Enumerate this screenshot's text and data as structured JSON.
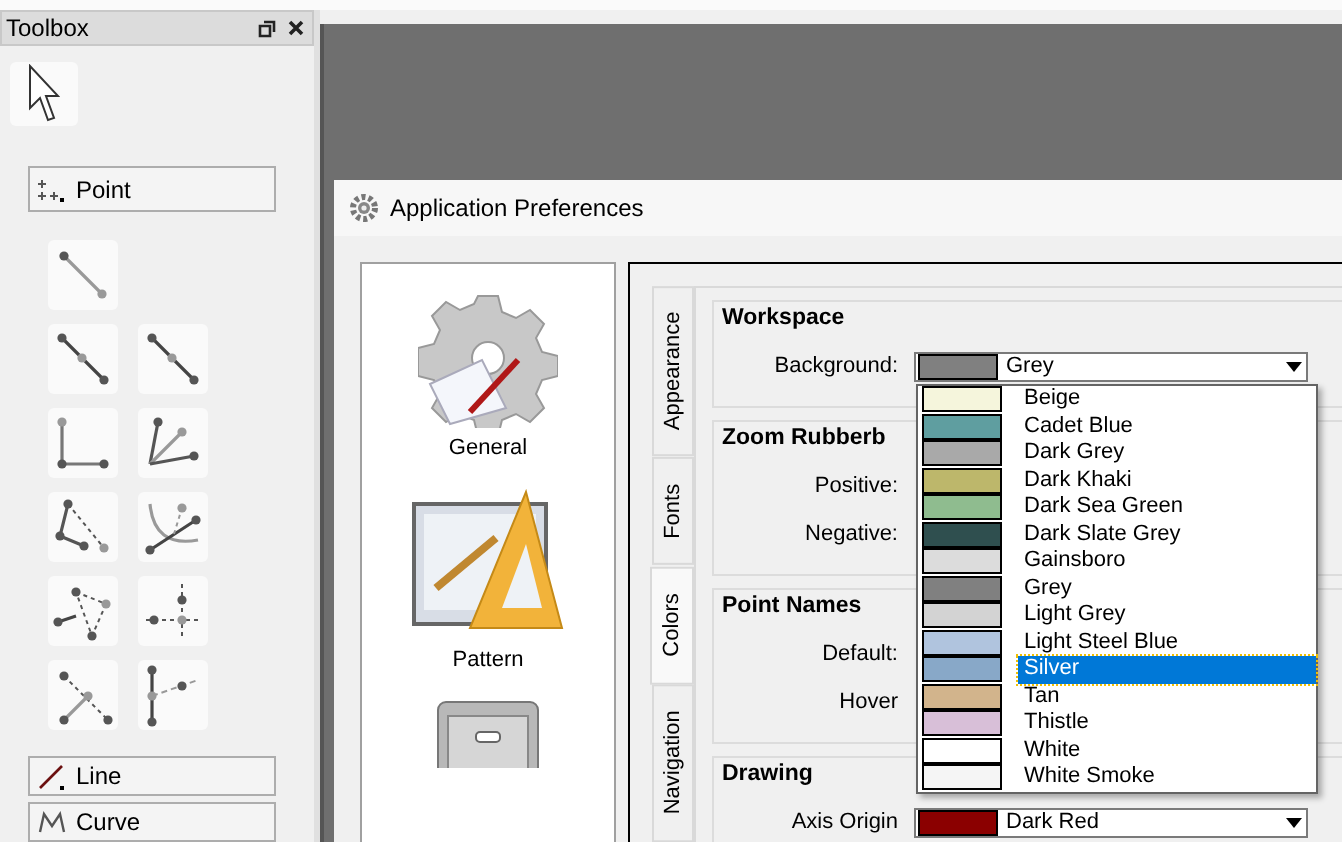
{
  "toolbox": {
    "title": "Toolbox",
    "sections": [
      {
        "label": "Point",
        "kind": "point"
      },
      {
        "label": "Line",
        "kind": "line"
      },
      {
        "label": "Curve",
        "kind": "curve"
      }
    ]
  },
  "dialog": {
    "title": "Application Preferences",
    "pages": [
      {
        "label": "General",
        "kind": "gear"
      },
      {
        "label": "Pattern",
        "kind": "pattern"
      },
      {
        "kind": "cabinet"
      }
    ],
    "tabs": [
      {
        "label": "Appearance",
        "selected": false
      },
      {
        "label": "Fonts",
        "selected": false
      },
      {
        "label": "Colors",
        "selected": true
      },
      {
        "label": "Navigation",
        "selected": false
      }
    ],
    "groups": [
      {
        "title": "Workspace",
        "rows": [
          {
            "label": "Background:",
            "value": "Grey",
            "color": "#808080"
          }
        ]
      },
      {
        "title": "Zoom Rubberb",
        "rows": [
          {
            "label": "Positive:"
          },
          {
            "label": "Negative:"
          }
        ]
      },
      {
        "title": "Point Names",
        "rows": [
          {
            "label": "Default:"
          },
          {
            "label": "Hover"
          }
        ]
      },
      {
        "title": "Drawing",
        "rows": [
          {
            "label": "Axis Origin",
            "value": "Dark Red",
            "color": "#8b0000"
          }
        ]
      }
    ],
    "dropdown": [
      {
        "label": "Beige",
        "color": "#f5f5dc",
        "selected": false
      },
      {
        "label": "Cadet Blue",
        "color": "#5f9ea0",
        "selected": false
      },
      {
        "label": "Dark Grey",
        "color": "#a9a9a9",
        "selected": false
      },
      {
        "label": "Dark Khaki",
        "color": "#bdb76b",
        "selected": false
      },
      {
        "label": "Dark Sea Green",
        "color": "#8fbc8f",
        "selected": false
      },
      {
        "label": "Dark Slate Grey",
        "color": "#2f4f4f",
        "selected": false
      },
      {
        "label": "Gainsboro",
        "color": "#dcdcdc",
        "selected": false
      },
      {
        "label": "Grey",
        "color": "#808080",
        "selected": false
      },
      {
        "label": "Light Grey",
        "color": "#d3d3d3",
        "selected": false
      },
      {
        "label": "Light Steel Blue",
        "color": "#b0c4de",
        "selected": false
      },
      {
        "label": "Silver",
        "color": "#88a8c8",
        "selected": true
      },
      {
        "label": "Tan",
        "color": "#d2b48c",
        "selected": false
      },
      {
        "label": "Thistle",
        "color": "#d8bfd8",
        "selected": false
      },
      {
        "label": "White",
        "color": "#ffffff",
        "selected": false
      },
      {
        "label": "White Smoke",
        "color": "#f5f5f5",
        "selected": false
      }
    ]
  }
}
